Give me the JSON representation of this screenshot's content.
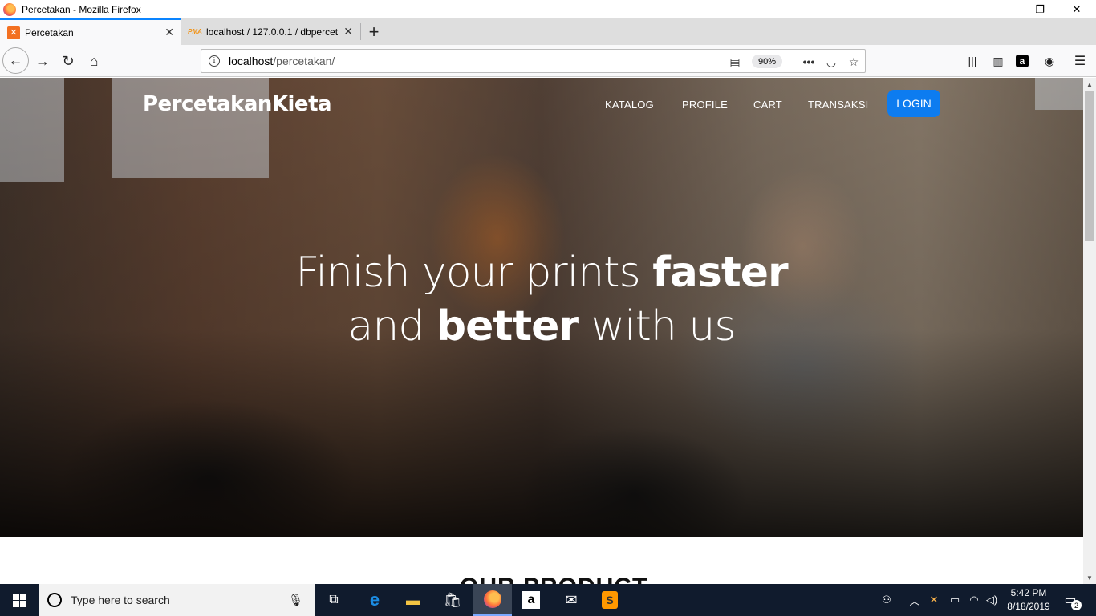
{
  "window": {
    "title": "Percetakan - Mozilla Firefox",
    "controls": {
      "minimize": "—",
      "restore": "❐",
      "close": "✕"
    }
  },
  "tabs": [
    {
      "label": "Percetakan",
      "icon": "xampp-icon",
      "active": true
    },
    {
      "label": "localhost / 127.0.0.1 / dbpercet",
      "icon": "phpmyadmin-icon",
      "active": false
    }
  ],
  "toolbar": {
    "url_host": "localhost",
    "url_path": "/percetakan/",
    "zoom": "90%",
    "icons": [
      "back-icon",
      "forward-icon",
      "reload-icon",
      "home-icon",
      "reader-view-icon",
      "page-actions-icon",
      "pocket-icon",
      "bookmark-star-icon",
      "library-icon",
      "sidebar-icon",
      "amazon-icon",
      "account-icon",
      "menu-icon"
    ]
  },
  "page": {
    "brand": "PercetakanKieta",
    "nav": [
      "KATALOG",
      "PROFILE",
      "CART",
      "TRANSAKSI"
    ],
    "login": "LOGIN",
    "headline": {
      "line1_plain": "Finish your prints ",
      "line1_bold": "faster",
      "line2_plain_a": "and ",
      "line2_bold": "better",
      "line2_plain_b": " with us"
    },
    "section_title": "OUR PRODUCT"
  },
  "taskbar": {
    "search_placeholder": "Type here to search",
    "apps": [
      "task-view-icon",
      "edge-icon",
      "file-explorer-icon",
      "store-icon",
      "firefox-icon",
      "amazon-icon",
      "mail-icon",
      "sublime-icon"
    ],
    "time": "5:42 PM",
    "date": "8/18/2019",
    "notification_count": "2"
  }
}
